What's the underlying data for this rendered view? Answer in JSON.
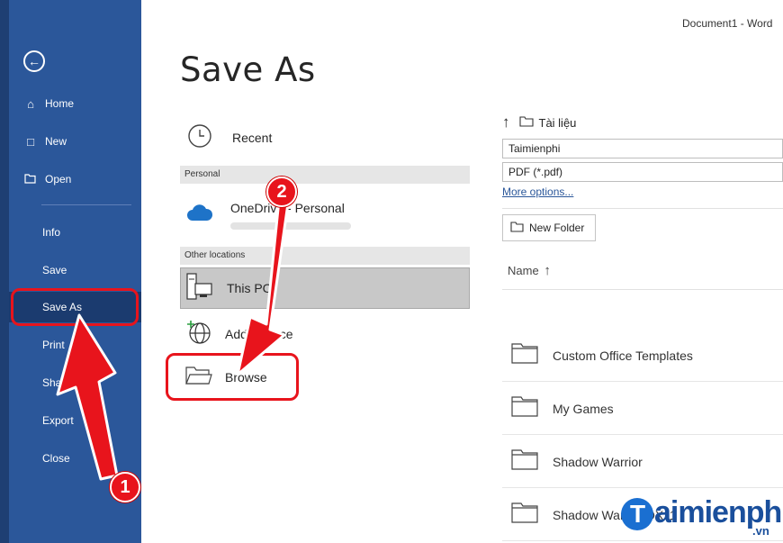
{
  "window": {
    "title": "Document1  -  Word"
  },
  "sidebar": {
    "items": [
      {
        "label": "Home",
        "icon": "home-icon"
      },
      {
        "label": "New",
        "icon": "new-doc-icon"
      },
      {
        "label": "Open",
        "icon": "open-folder-icon"
      },
      {
        "label": "Info"
      },
      {
        "label": "Save"
      },
      {
        "label": "Save As"
      },
      {
        "label": "Print"
      },
      {
        "label": "Share"
      },
      {
        "label": "Export"
      },
      {
        "label": "Close"
      }
    ]
  },
  "page": {
    "title": "Save As"
  },
  "locations": {
    "recent": "Recent",
    "personal_header": "Personal",
    "onedrive": "OneDrive - Personal",
    "other_header": "Other locations",
    "this_pc": "This PC",
    "add_place": "Add a Place",
    "browse": "Browse"
  },
  "file_pane": {
    "current_folder": "Tài liệu",
    "filename": "Taimienphi",
    "filetype": "PDF (*.pdf)",
    "more_options": "More options...",
    "new_folder": "New Folder",
    "column_name": "Name",
    "folders": [
      "Custom Office Templates",
      "My Games",
      "Shadow Warrior",
      "Shadow Warrior DX11"
    ]
  },
  "annotations": {
    "step1": "1",
    "step2": "2"
  },
  "watermark": {
    "text": "aimienphi",
    "badge": "T",
    "suffix": ".vn"
  },
  "colors": {
    "sidebar": "#2b579a",
    "highlight": "#e8141c",
    "link": "#2b579a"
  }
}
